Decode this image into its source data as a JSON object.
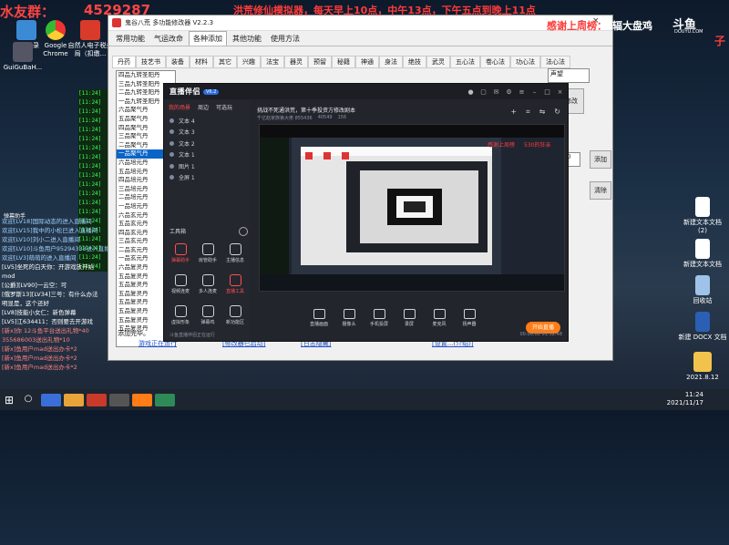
{
  "overlays": {
    "top_left_handle": "水友群：",
    "top_left_number": "4529287",
    "top_center_marquee": "洪荒修仙模拟器，每天早上10点，中午13点，下午五点到晚上11点",
    "thanks_text": "感谢上周榜：",
    "thanks_name": "辐大盘鸡",
    "platform_logo": "斗鱼",
    "platform_domain": "DOUYU.COM",
    "right_red_fragment": "子"
  },
  "desktop_icons_left": [
    {
      "label": "聊天记录"
    },
    {
      "label": "Google Chrome"
    },
    {
      "label": "自然人电子税务局（扣缴..."
    },
    {
      "label": "GuiGuBaH..."
    }
  ],
  "desktop_icons_right": [
    {
      "label": "新建文本文档 (2)"
    },
    {
      "label": "新建文本文档"
    },
    {
      "label": "回收站"
    },
    {
      "label": "新建 DOCX 文档"
    },
    {
      "label": "2021.8.12"
    }
  ],
  "chat": {
    "title": "弹幕助手",
    "lines": [
      {
        "text": "欢迎[LV18]国际动态的进入直播间",
        "c": "blue"
      },
      {
        "text": "欢迎[LV15]我中的小松已进入直播间",
        "c": "blue"
      },
      {
        "text": "欢迎[LV10]刘小二进入直播间",
        "c": "blue"
      },
      {
        "text": "欢迎[LV10]斗鱼用户95294333进入直播间",
        "c": "blue"
      },
      {
        "text": "欢迎[LV3]萌萌的进入直播间",
        "c": "blue"
      },
      {
        "text": "[LV5]坐死的白天你：开游戏放开始",
        "c": "white"
      },
      {
        "text": "mod",
        "c": "white"
      },
      {
        "text": "[公爵][LV90]一云空：可",
        "c": "white"
      },
      {
        "text": "[俄罗斯13][LV34]三号：有什么办法",
        "c": "white"
      },
      {
        "text": "明显是，这个还好",
        "c": "white"
      },
      {
        "text": "[LV8]技能小女仁：新色弹幕",
        "c": "white"
      },
      {
        "text": "[LV5]江634411：否则要去开游戏",
        "c": "white"
      },
      {
        "text": "[新x]你 12斗鱼平台送出礼物*40",
        "c": "red"
      },
      {
        "text": "355686003送出礼物*10",
        "c": "red"
      },
      {
        "text": "[新x]鱼用户mad送出办卡*2",
        "c": "red"
      },
      {
        "text": "[新x]鱼用户mad送出办卡*2",
        "c": "red"
      },
      {
        "text": "[新x]鱼用户mad送出办卡*2",
        "c": "red"
      }
    ]
  },
  "green_console": [
    "[11:24]",
    "[11:24]",
    "[11:24]",
    "[11:24]",
    "[11:24]",
    "[11:24]",
    "[11:24]",
    "[11:24]",
    "[11:24]",
    "[11:24]",
    "[11:24]",
    "[11:24]",
    "[11:24]",
    "[11:24]",
    "[11:24]",
    "[11:24]",
    "[11:24]",
    "[11:24]",
    "[11:24]",
    "[11:24]"
  ],
  "modifier": {
    "window_title": "鬼谷八荒 多功能修改器 V2.2.3",
    "menu": [
      "常用功能",
      "气运改命",
      "各种添加",
      "其他功能",
      "使用方法"
    ],
    "active_menu": 2,
    "subtabs": [
      "丹药",
      "技艺书",
      "装备",
      "材料",
      "其它",
      "兴趣",
      "法宝",
      "器灵",
      "预留",
      "秘籍",
      "神通",
      "身法",
      "绝技",
      "武灵",
      "五心法",
      "卷心法",
      "功心法",
      "法心法"
    ],
    "active_subtab": 0,
    "items": [
      "四品九转圣阳丹",
      "三品九转圣阳丹",
      "二品九转圣阳丹",
      "一品九转圣阳丹",
      "六品聚气丹",
      "五品聚气丹",
      "四品聚气丹",
      "三品聚气丹",
      "二品聚气丹",
      "一品聚气丹",
      "六品培元丹",
      "五品培元丹",
      "四品培元丹",
      "三品培元丹",
      "二品培元丹",
      "一品培元丹",
      "六品玄元丹",
      "五品玄元丹",
      "四品玄元丹",
      "三品玄元丹",
      "二品玄元丹",
      "一品玄元丹",
      "六品复灵丹",
      "五品复灵丹",
      "五品复灵丹",
      "五品复灵丹",
      "五品复灵丹",
      "五品复灵丹",
      "五品复灵丹",
      "五品复灵丹"
    ],
    "selected_item": 9,
    "done_text": "添加完毕。",
    "right_field_value": "声望",
    "right_field_label": "修改",
    "qty_value": "0",
    "add_label": "添加",
    "clear_label": "清除",
    "links": [
      "游戏正在运行",
      "[修改器已启动]",
      "[日志隐藏]",
      "[设置...(介绍)]"
    ]
  },
  "stream_app": {
    "logo": "直播伴侣",
    "version": "V6.2",
    "side_tabs": [
      "我的场景",
      "周边",
      "可选玩"
    ],
    "active_side_tab": 0,
    "scenes": [
      "文本 4",
      "文本 3",
      "文本 2",
      "文本 1",
      "图片 1",
      "全屏 1"
    ],
    "tools_title": "工具箱",
    "tools": [
      {
        "label": "弹幕助手",
        "red": true
      },
      {
        "label": "房管助手",
        "red": false
      },
      {
        "label": "主播信息",
        "red": false
      },
      {
        "label": "视频连麦",
        "red": false
      },
      {
        "label": "多人连麦",
        "red": false
      },
      {
        "label": "直播工具",
        "red": true
      },
      {
        "label": "虚拟形象",
        "red": false
      },
      {
        "label": "弹幕鸡",
        "red": false
      },
      {
        "label": "新功能区",
        "red": false
      }
    ],
    "stream_title": "挑战不死通洪荒，第十季投资方修改剧本",
    "stats_room": "千亿赵家族第大佬 855436",
    "stats_fans": "40549",
    "stats_likes": "156",
    "preview_text_red": "感谢上周榜",
    "preview_text_red2": "530的狂亲",
    "controls": [
      "直播画面",
      "摄像头",
      "手机投屏",
      "录屏",
      "麦克风",
      "扬声器"
    ],
    "start_label": "开始直播",
    "status_left": "斗鱼直播伴侣正在运行",
    "status_right": "00:00:00  01:52:48"
  },
  "taskbar": {
    "time": "11:24",
    "date": "2021/11/17"
  },
  "colors": {
    "overlay_red": "#ff3b3b",
    "selection_blue": "#0a64c8",
    "start_orange": "#ff7c16",
    "console_green": "#3cff5a"
  }
}
